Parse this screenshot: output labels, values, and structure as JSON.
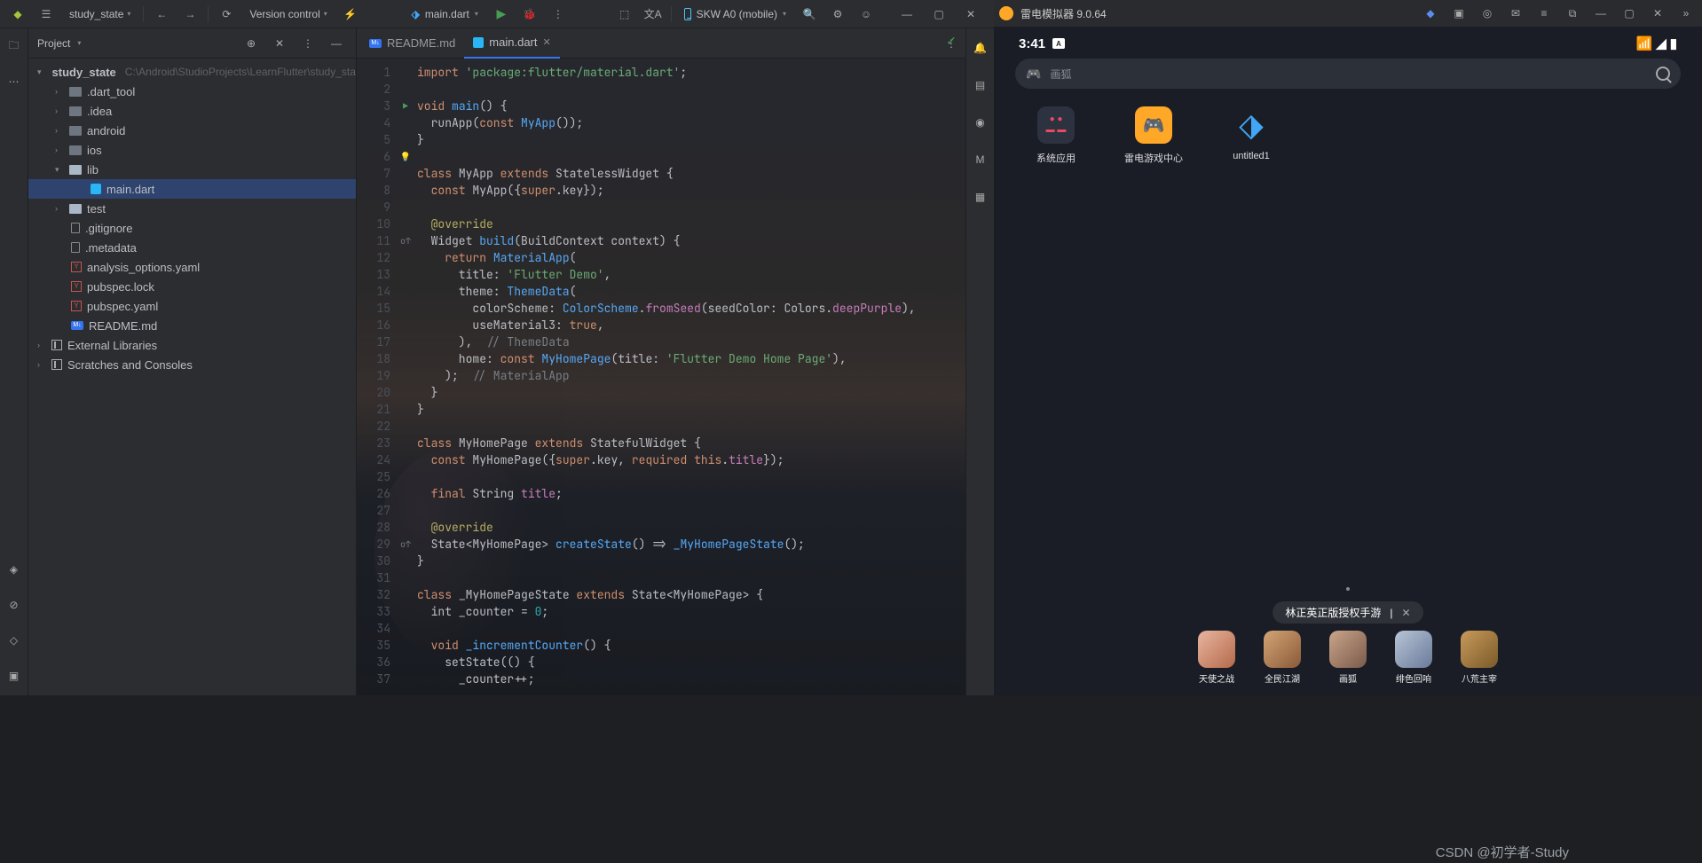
{
  "titlebar": {
    "project": "study_state",
    "vcs": "Version control",
    "run_config": "main.dart",
    "device": "SKW A0 (mobile)"
  },
  "sidebar": {
    "title": "Project",
    "root_name": "study_state",
    "root_path": "C:\\Android\\StudioProjects\\LearnFlutter\\study_state",
    "items": {
      "dart_tool": ".dart_tool",
      "idea": ".idea",
      "android": "android",
      "ios": "ios",
      "lib": "lib",
      "main_dart": "main.dart",
      "test": "test",
      "gitignore": ".gitignore",
      "metadata": ".metadata",
      "analysis": "analysis_options.yaml",
      "pubspec_lock": "pubspec.lock",
      "pubspec_yaml": "pubspec.yaml",
      "readme": "README.md",
      "ext_libs": "External Libraries",
      "scratches": "Scratches and Consoles"
    }
  },
  "tabs": {
    "readme": "README.md",
    "main": "main.dart"
  },
  "code": {
    "l1a": "import ",
    "l1b": "'package:flutter/material.dart'",
    "l1c": ";",
    "l3a": "void ",
    "l3b": "main",
    "l3c": "() {",
    "l4a": "  runApp(",
    "l4b": "const ",
    "l4c": "MyApp",
    "l4d": "());",
    "l5": "}",
    "l7a": "class ",
    "l7b": "MyApp ",
    "l7c": "extends ",
    "l7d": "StatelessWidget ",
    "l7e": "{",
    "l8a": "  ",
    "l8b": "const ",
    "l8c": "MyApp({",
    "l8d": "super",
    "l8e": ".key});",
    "l10": "  @override",
    "l11a": "  Widget ",
    "l11b": "build",
    "l11c": "(BuildContext context) {",
    "l12a": "    ",
    "l12b": "return ",
    "l12c": "MaterialApp",
    "l12d": "(",
    "l13a": "      title: ",
    "l13b": "'Flutter Demo'",
    "l13c": ",",
    "l14a": "      theme: ",
    "l14b": "ThemeData",
    "l14c": "(",
    "l15a": "        colorScheme: ",
    "l15b": "ColorScheme",
    "l15c": ".",
    "l15d": "fromSeed",
    "l15e": "(seedColor: Colors.",
    "l15f": "deepPurple",
    "l15g": "),",
    "l16a": "        useMaterial3: ",
    "l16b": "true",
    "l16c": ",",
    "l17a": "      ),  ",
    "l17b": "// ThemeData",
    "l18a": "      home: ",
    "l18b": "const ",
    "l18c": "MyHomePage",
    "l18d": "(title: ",
    "l18e": "'Flutter Demo Home Page'",
    "l18f": "),",
    "l19a": "    );  ",
    "l19b": "// MaterialApp",
    "l20": "  }",
    "l21": "}",
    "l23a": "class ",
    "l23b": "MyHomePage ",
    "l23c": "extends ",
    "l23d": "StatefulWidget ",
    "l23e": "{",
    "l24a": "  ",
    "l24b": "const ",
    "l24c": "MyHomePage({",
    "l24d": "super",
    "l24e": ".key, ",
    "l24f": "required ",
    "l24g": "this",
    "l24h": ".",
    "l24i": "title",
    "l24j": "});",
    "l26a": "  ",
    "l26b": "final ",
    "l26c": "String ",
    "l26d": "title",
    "l26e": ";",
    "l28": "  @override",
    "l29a": "  State<MyHomePage> ",
    "l29b": "createState",
    "l29c": "() => ",
    "l29d": "_MyHomePageState",
    "l29e": "();",
    "l30": "}",
    "l32a": "class ",
    "l32b": "_MyHomePageState ",
    "l32c": "extends ",
    "l32d": "State<MyHomePage> {",
    "l33a": "  int _counter = ",
    "l33b": "0",
    "l33c": ";",
    "l35a": "  ",
    "l35b": "void ",
    "l35c": "_incrementCounter",
    "l35d": "() {",
    "l36": "    setState(() {",
    "l37": "      _counter++;"
  },
  "emulator": {
    "title": "雷电模拟器 9.0.64",
    "time": "3:41",
    "lang_badge": "A",
    "search_placeholder": "画狐",
    "apps": {
      "sys": "系统应用",
      "play_center": "雷电游戏中心",
      "untitled": "untitled1"
    },
    "pill": "林正英正版授权手游",
    "dock": {
      "a1": "天使之战",
      "a2": "全民江湖",
      "a3": "画狐",
      "a4": "绯色回响",
      "a5": "八荒主宰"
    }
  },
  "watermark": "CSDN @初学者-Study"
}
